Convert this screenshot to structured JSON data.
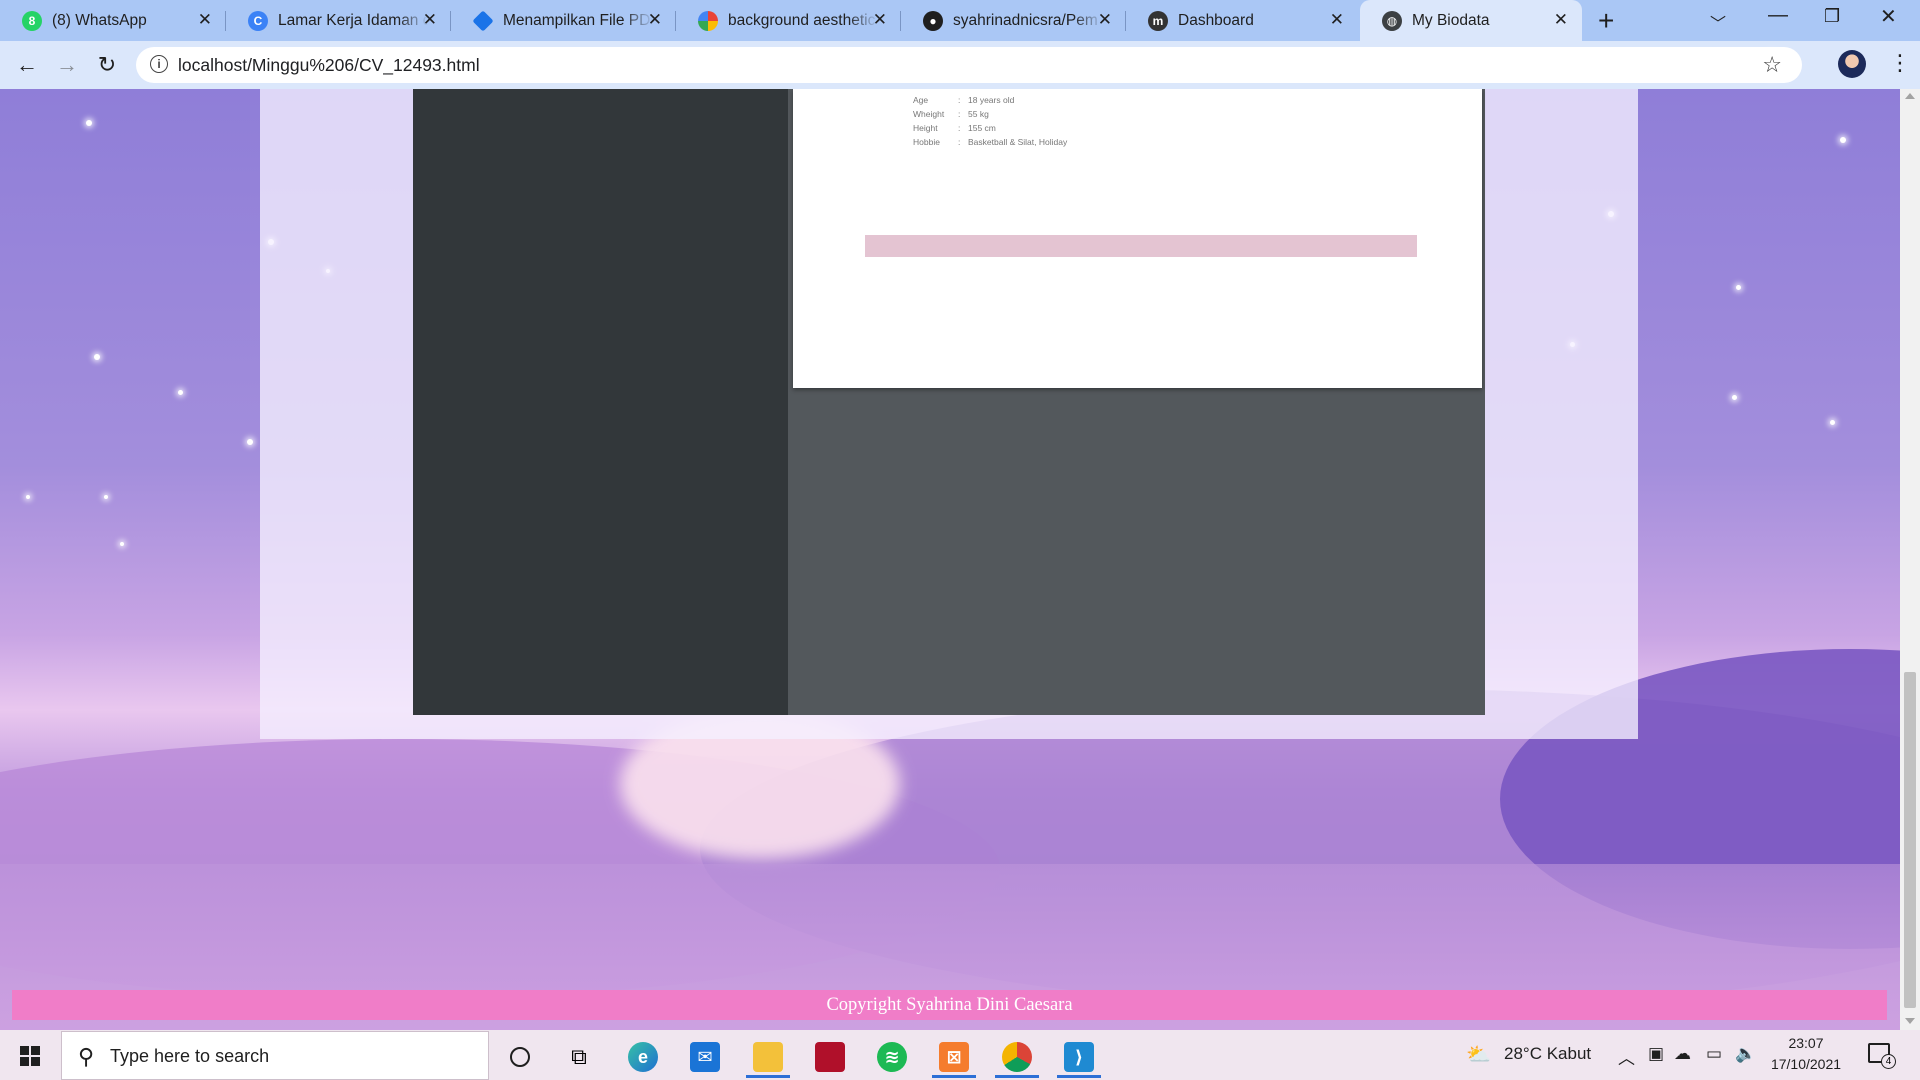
{
  "browser": {
    "tabs": [
      {
        "title": "(8) WhatsApp",
        "icon": "whatsapp-icon",
        "color": "#25d366"
      },
      {
        "title": "Lamar Kerja Idaman di",
        "icon": "canva-icon",
        "color": "#3b82f6"
      },
      {
        "title": "Menampilkan File PDF",
        "icon": "code-icon",
        "color": "#1a73e8"
      },
      {
        "title": "background aesthetic",
        "icon": "google-icon",
        "color": "#4285f4"
      },
      {
        "title": "syahrinadnicsra/Pem",
        "icon": "github-icon",
        "color": "#1f1f1f"
      },
      {
        "title": "Dashboard",
        "icon": "moodle-icon",
        "color": "#333333"
      },
      {
        "title": "My Biodata",
        "icon": "globe-icon",
        "color": "#3c4043"
      }
    ],
    "url": "localhost/Minggu%206/CV_12493.html"
  },
  "biodata": {
    "rows": [
      {
        "label": "Age",
        "value": "18 years old"
      },
      {
        "label": "Wheight",
        "value": "55 kg"
      },
      {
        "label": "Height",
        "value": "155 cm"
      },
      {
        "label": "Hobbie",
        "value": "Basketball & Silat, Holiday"
      }
    ]
  },
  "footer": {
    "text": "Copyright Syahrina Dini Caesara"
  },
  "taskbar": {
    "search_placeholder": "Type here to search",
    "weather": "28°C  Kabut",
    "time": "23:07",
    "date": "17/10/2021",
    "notification_count": "4"
  }
}
